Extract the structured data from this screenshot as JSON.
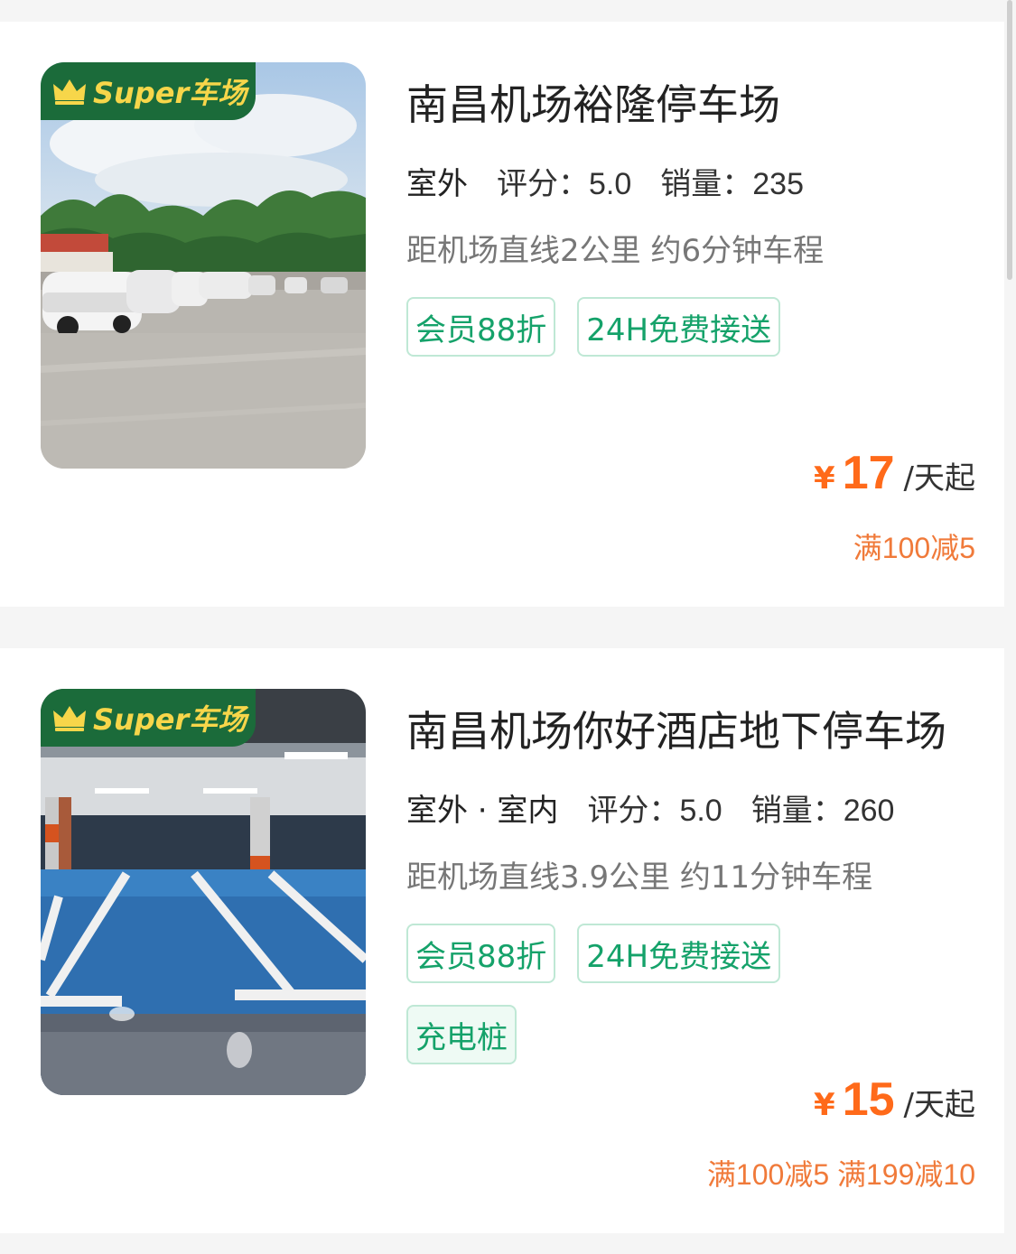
{
  "badge_label": "Super车场",
  "listings": [
    {
      "title": "南昌机场裕隆停车场",
      "type": "室外",
      "rating_label": "评分：",
      "rating": "5.0",
      "sales_label": "销量：",
      "sales": "235",
      "distance": "距机场直线2公里 约6分钟车程",
      "tags": [
        "会员88折",
        "24H免费接送"
      ],
      "price_symbol": "¥",
      "price": "17",
      "price_unit": "/天起",
      "discount": "满100减5"
    },
    {
      "title": "南昌机场你好酒店地下停车场",
      "type": "室外 · 室内",
      "rating_label": "评分：",
      "rating": "5.0",
      "sales_label": "销量：",
      "sales": "260",
      "distance": "距机场直线3.9公里 约11分钟车程",
      "tags": [
        "会员88折",
        "24H免费接送",
        "充电桩"
      ],
      "price_symbol": "¥",
      "price": "15",
      "price_unit": "/天起",
      "discount": "满100减5 满199减10"
    }
  ],
  "colors": {
    "accent_green": "#15a26a",
    "badge_green": "#1b6b3a",
    "badge_text": "#f7d64a",
    "price_orange": "#ff6a1a",
    "discount_orange": "#f07a3a"
  }
}
